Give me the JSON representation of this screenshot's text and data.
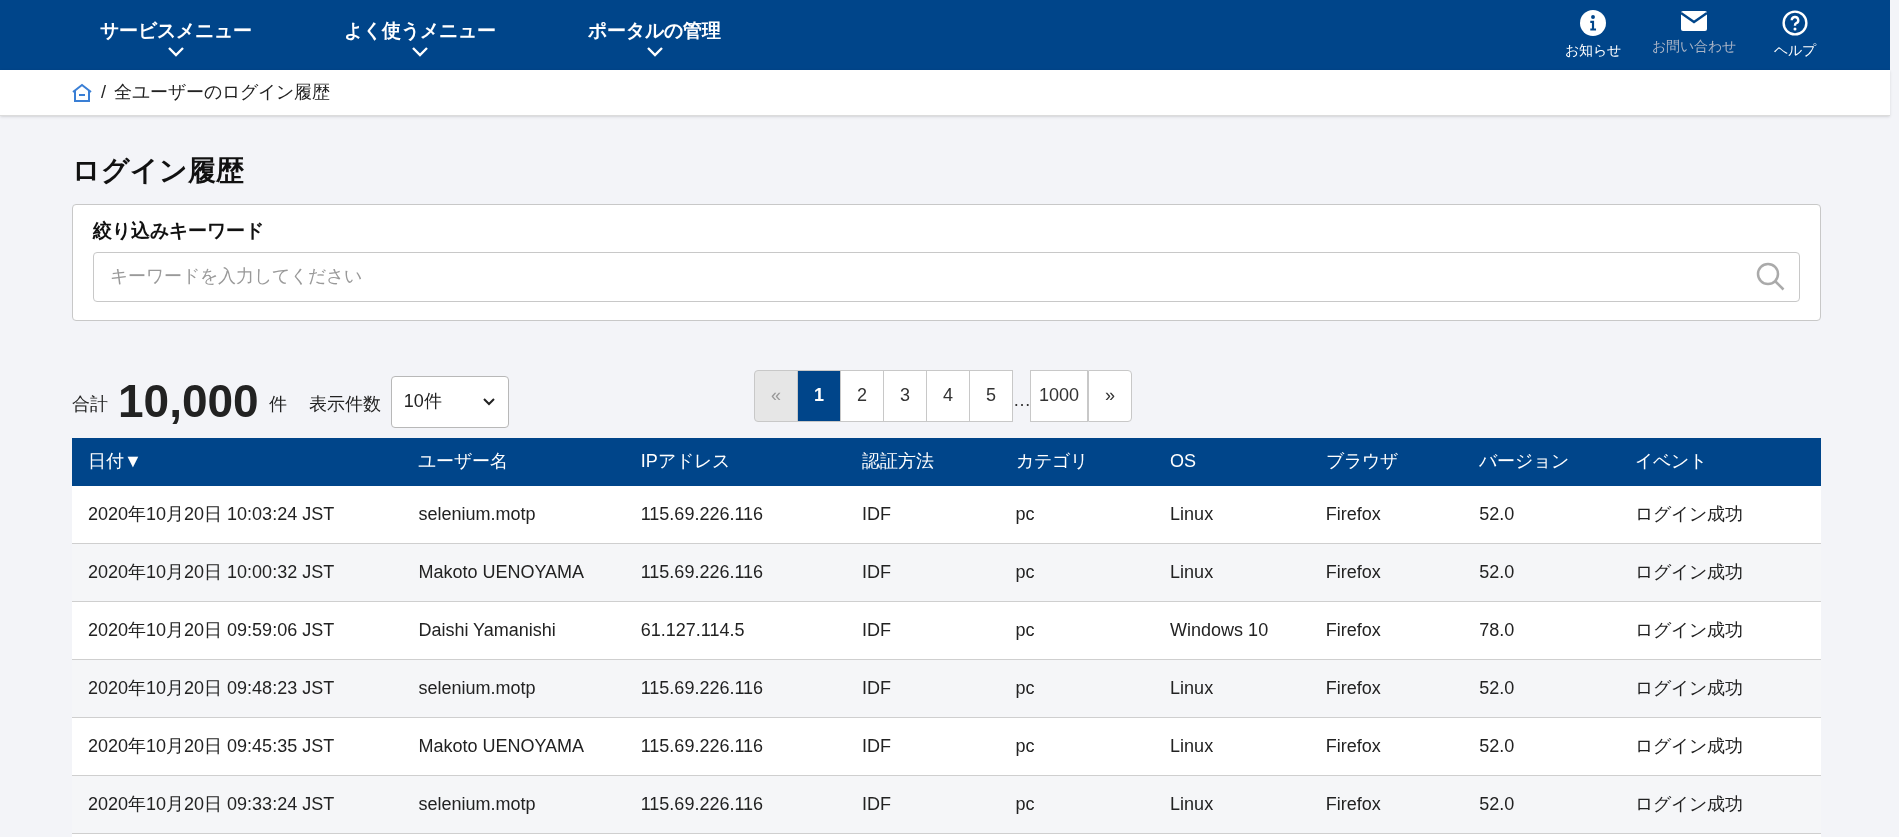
{
  "nav": {
    "menus": [
      {
        "label": "サービスメニュー"
      },
      {
        "label": "よく使うメニュー"
      },
      {
        "label": "ポータルの管理"
      }
    ],
    "actions": [
      {
        "kind": "info",
        "label": "お知らせ",
        "disabled": false
      },
      {
        "kind": "mail",
        "label": "お問い合わせ",
        "disabled": true
      },
      {
        "kind": "help",
        "label": "ヘルプ",
        "disabled": false
      }
    ]
  },
  "breadcrumb": {
    "separator": "/",
    "current": "全ユーザーのログイン履歴"
  },
  "page_title": "ログイン履歴",
  "filter": {
    "label": "絞り込みキーワード",
    "placeholder": "キーワードを入力してください"
  },
  "summary": {
    "total_label": "合計",
    "total": "10,000",
    "unit": "件",
    "page_size_label": "表示件数",
    "page_size": "10件"
  },
  "pagination": [
    {
      "kind": "prev",
      "label": "«",
      "disabled": true
    },
    {
      "kind": "page",
      "label": "1",
      "selected": true
    },
    {
      "kind": "page",
      "label": "2",
      "selected": false
    },
    {
      "kind": "page",
      "label": "3",
      "selected": false
    },
    {
      "kind": "page",
      "label": "4",
      "selected": false
    },
    {
      "kind": "page",
      "label": "5",
      "selected": false
    },
    {
      "kind": "ellipsis",
      "label": "…"
    },
    {
      "kind": "page",
      "label": "1000",
      "selected": false
    },
    {
      "kind": "next",
      "label": "»",
      "disabled": false
    }
  ],
  "table": {
    "columns": [
      "日付▼",
      "ユーザー名",
      "IPアドレス",
      "認証方法",
      "カテゴリ",
      "OS",
      "ブラウザ",
      "バージョン",
      "イベント"
    ],
    "rows": [
      [
        "2020年10月20日 10:03:24 JST",
        "selenium.motp",
        "115.69.226.116",
        "IDF",
        "pc",
        "Linux",
        "Firefox",
        "52.0",
        "ログイン成功"
      ],
      [
        "2020年10月20日 10:00:32 JST",
        "Makoto UENOYAMA",
        "115.69.226.116",
        "IDF",
        "pc",
        "Linux",
        "Firefox",
        "52.0",
        "ログイン成功"
      ],
      [
        "2020年10月20日 09:59:06 JST",
        "Daishi Yamanishi",
        "61.127.114.5",
        "IDF",
        "pc",
        "Windows 10",
        "Firefox",
        "78.0",
        "ログイン成功"
      ],
      [
        "2020年10月20日 09:48:23 JST",
        "selenium.motp",
        "115.69.226.116",
        "IDF",
        "pc",
        "Linux",
        "Firefox",
        "52.0",
        "ログイン成功"
      ],
      [
        "2020年10月20日 09:45:35 JST",
        "Makoto UENOYAMA",
        "115.69.226.116",
        "IDF",
        "pc",
        "Linux",
        "Firefox",
        "52.0",
        "ログイン成功"
      ],
      [
        "2020年10月20日 09:33:24 JST",
        "selenium.motp",
        "115.69.226.116",
        "IDF",
        "pc",
        "Linux",
        "Firefox",
        "52.0",
        "ログイン成功"
      ]
    ]
  }
}
